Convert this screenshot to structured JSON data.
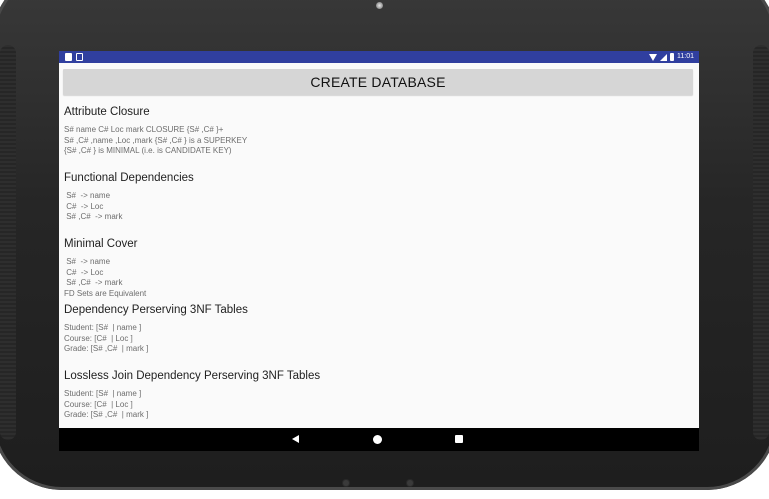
{
  "status_bar": {
    "time": "11:01",
    "left_icons": [
      "sim-card-icon",
      "notification-icon"
    ],
    "right_icons": [
      "wifi-icon",
      "signal-icon",
      "battery-icon"
    ],
    "color": "#303f9f"
  },
  "create_button": {
    "label": "CREATE DATABASE"
  },
  "sections": [
    {
      "title": "Attribute Closure",
      "lines": [
        "S# name C# Loc mark CLOSURE {S# ,C# }+",
        "S# ,C# ,name ,Loc ,mark {S# ,C# } is a SUPERKEY",
        "{S# ,C# } is MINIMAL (i.e. is CANDIDATE KEY)"
      ]
    },
    {
      "title": "Functional Dependencies",
      "lines": [
        " S#  -> name",
        " C#  -> Loc",
        " S# ,C#  -> mark"
      ]
    },
    {
      "title": "Minimal Cover",
      "lines": [
        " S#  -> name",
        " C#  -> Loc",
        " S# ,C#  -> mark",
        "FD Sets are Equivalent"
      ]
    },
    {
      "title": "Dependency Perserving 3NF Tables",
      "lines": [
        "Student: [S#  | name ]",
        "Course: [C#  | Loc ]",
        "Grade: [S# ,C#  | mark ]"
      ]
    },
    {
      "title": "Lossless Join Dependency Perserving 3NF Tables",
      "lines": [
        "Student: [S#  | name ]",
        "Course: [C#  | Loc ]",
        "Grade: [S# ,C#  | mark ]"
      ]
    }
  ],
  "nav_bar": {
    "buttons": [
      "back-icon",
      "home-icon",
      "recents-icon"
    ]
  }
}
